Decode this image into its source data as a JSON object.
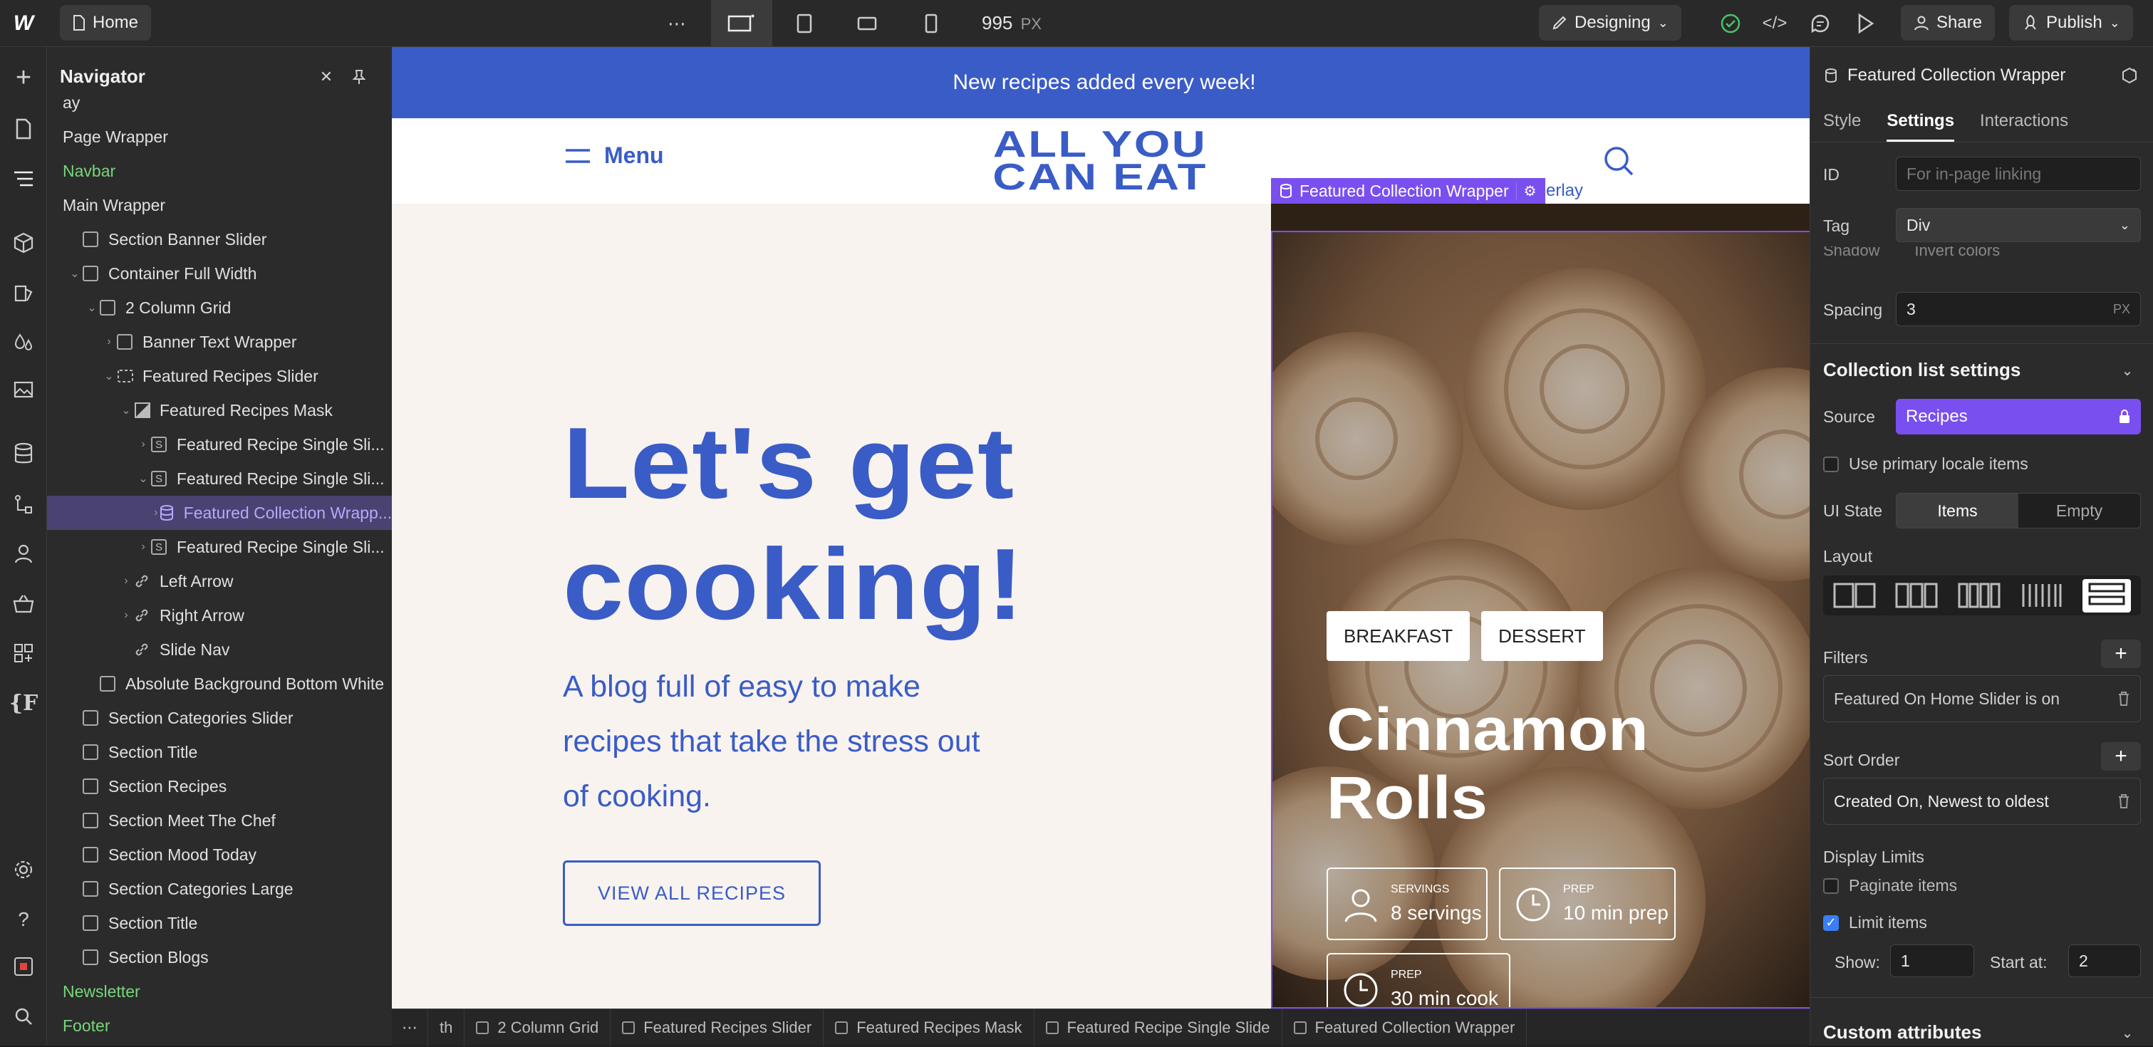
{
  "topbar": {
    "page": "Home",
    "more": "⋯",
    "width_value": "995",
    "width_unit": "PX",
    "mode": "Designing",
    "share": "Share",
    "publish": "Publish"
  },
  "navigator": {
    "title": "Navigator",
    "rows": [
      {
        "label": "ay",
        "indent": 0,
        "caret": "",
        "icon": "none",
        "green": false
      },
      {
        "label": "Page Wrapper",
        "indent": 0,
        "caret": "",
        "icon": "none",
        "green": false
      },
      {
        "label": "Navbar",
        "indent": 0,
        "caret": "",
        "icon": "none",
        "green": true
      },
      {
        "label": "Main Wrapper",
        "indent": 0,
        "caret": "",
        "icon": "none",
        "green": false
      },
      {
        "label": "Section Banner Slider",
        "indent": 1,
        "caret": "",
        "icon": "box",
        "green": false
      },
      {
        "label": "Container Full Width",
        "indent": 1,
        "caret": "⌄",
        "icon": "box",
        "green": false
      },
      {
        "label": "2 Column Grid",
        "indent": 2,
        "caret": "⌄",
        "icon": "box",
        "green": false
      },
      {
        "label": "Banner Text Wrapper",
        "indent": 3,
        "caret": "›",
        "icon": "box",
        "green": false
      },
      {
        "label": "Featured Recipes Slider",
        "indent": 3,
        "caret": "⌄",
        "icon": "slider",
        "green": false
      },
      {
        "label": "Featured Recipes Mask",
        "indent": 4,
        "caret": "⌄",
        "icon": "mask",
        "green": false
      },
      {
        "label": "Featured Recipe Single Sli...",
        "indent": 5,
        "caret": "›",
        "icon": "S",
        "green": false
      },
      {
        "label": "Featured Recipe Single Sli...",
        "indent": 5,
        "caret": "⌄",
        "icon": "S",
        "green": false
      },
      {
        "label": "Featured Collection Wrapp...",
        "indent": 6,
        "caret": "›",
        "icon": "db",
        "green": false,
        "selected": true
      },
      {
        "label": "Featured Recipe Single Sli...",
        "indent": 5,
        "caret": "›",
        "icon": "S",
        "green": false
      },
      {
        "label": "Left Arrow",
        "indent": 4,
        "caret": "›",
        "icon": "link",
        "green": false
      },
      {
        "label": "Right Arrow",
        "indent": 4,
        "caret": "›",
        "icon": "link",
        "green": false
      },
      {
        "label": "Slide Nav",
        "indent": 4,
        "caret": "",
        "icon": "link",
        "green": false
      },
      {
        "label": "Absolute Background Bottom White",
        "indent": 2,
        "caret": "",
        "icon": "box",
        "green": false
      },
      {
        "label": "Section Categories Slider",
        "indent": 1,
        "caret": "",
        "icon": "box",
        "green": false
      },
      {
        "label": "Section Title",
        "indent": 1,
        "caret": "",
        "icon": "box",
        "green": false
      },
      {
        "label": "Section Recipes",
        "indent": 1,
        "caret": "",
        "icon": "box",
        "green": false
      },
      {
        "label": "Section Meet The Chef",
        "indent": 1,
        "caret": "",
        "icon": "box",
        "green": false
      },
      {
        "label": "Section Mood Today",
        "indent": 1,
        "caret": "",
        "icon": "box",
        "green": false
      },
      {
        "label": "Section Categories Large",
        "indent": 1,
        "caret": "",
        "icon": "box",
        "green": false
      },
      {
        "label": "Section Title",
        "indent": 1,
        "caret": "",
        "icon": "box",
        "green": false
      },
      {
        "label": "Section Blogs",
        "indent": 1,
        "caret": "",
        "icon": "box",
        "green": false
      },
      {
        "label": "Newsletter",
        "indent": 0,
        "caret": "",
        "icon": "none",
        "green": true
      },
      {
        "label": "Footer",
        "indent": 0,
        "caret": "",
        "icon": "none",
        "green": true
      }
    ]
  },
  "site": {
    "announcement": "New recipes added every week!",
    "menu": "Menu",
    "logo_line1": "ALL YOU",
    "logo_line2": "CAN EAT",
    "headline_line1": "Let's get",
    "headline_line2": "cooking!",
    "subtext_line1": "A blog full of easy to make",
    "subtext_line2": "recipes that take the stress out",
    "subtext_line3": "of cooking.",
    "cta": "VIEW ALL RECIPES",
    "selected_label": "Featured Collection Wrapper",
    "overlay_fragment": "erlay",
    "tags": [
      "BREAKFAST",
      "DESSERT"
    ],
    "recipe_title_line1": "Cinnamon",
    "recipe_title_line2": "Rolls",
    "stats": [
      {
        "label": "SERVINGS",
        "value": "8 servings"
      },
      {
        "label": "PREP",
        "value": "10 min prep"
      },
      {
        "label": "PREP",
        "value": "30 min cook"
      }
    ]
  },
  "breadcrumbs": [
    "th",
    "2 Column Grid",
    "Featured Recipes Slider",
    "Featured Recipes Mask",
    "Featured Recipe Single Slide",
    "Featured Collection Wrapper"
  ],
  "rightpanel": {
    "element": "Featured Collection Wrapper",
    "tabs": [
      "Style",
      "Settings",
      "Interactions"
    ],
    "id_label": "ID",
    "id_placeholder": "For in-page linking",
    "tag_label": "Tag",
    "tag_value": "Div",
    "partial_line": "Shadow        Invert colors",
    "spacing_label": "Spacing",
    "spacing_value": "3",
    "spacing_unit": "PX",
    "collection_heading": "Collection list settings",
    "source_label": "Source",
    "source_value": "Recipes",
    "primary_locale": "Use primary locale items",
    "ui_state_label": "UI State",
    "ui_state_items": "Items",
    "ui_state_empty": "Empty",
    "layout_label": "Layout",
    "filters_label": "Filters",
    "filter_value": "Featured On Home Slider is on",
    "sort_label": "Sort Order",
    "sort_value": "Created On, Newest to oldest",
    "display_limits": "Display Limits",
    "paginate": "Paginate items",
    "limit": "Limit items",
    "show_label": "Show:",
    "show_value": "1",
    "start_label": "Start at:",
    "start_value": "2",
    "custom_attrs": "Custom attributes"
  },
  "colors": {
    "brand_blue": "#3a5cc7",
    "accent_purple": "#7a4ff0",
    "green": "#77d67a"
  }
}
